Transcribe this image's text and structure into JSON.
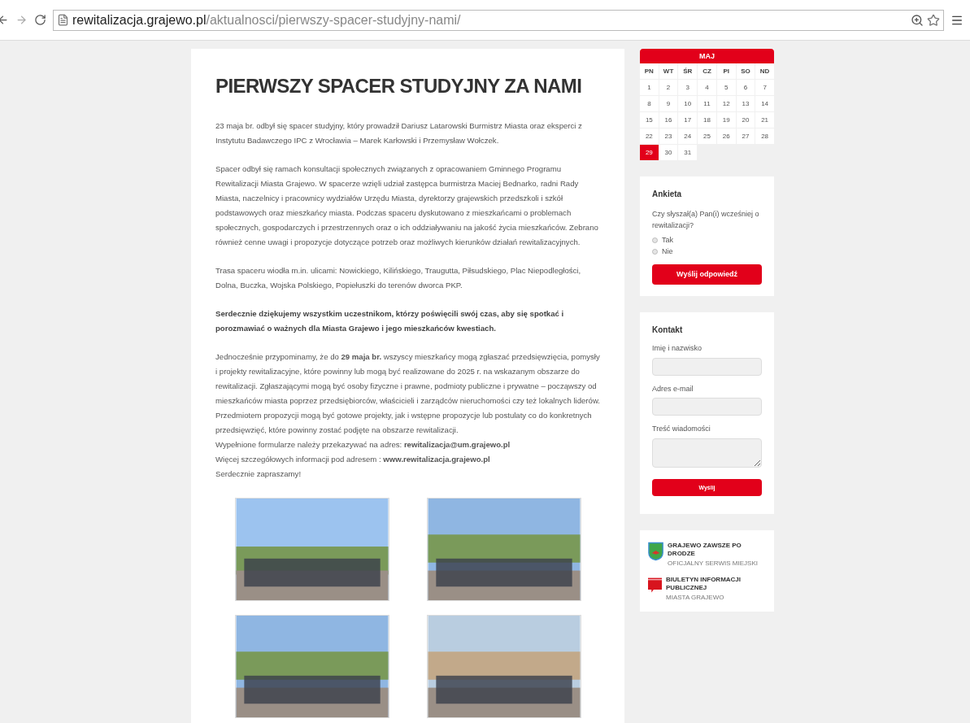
{
  "browser": {
    "url_host": "rewitalizacja.grajewo.pl",
    "url_path": "/aktualnosci/pierwszy-spacer-studyjny-nami/"
  },
  "article": {
    "title": "PIERWSZY SPACER STUDYJNY ZA NAMI",
    "paragraphs": [
      {
        "kind": "text",
        "text": "23 maja br. odbył się spacer studyjny, który prowadził Dariusz Latarowski Burmistrz Miasta oraz eksperci z Instytutu Badawczego IPC z Wrocławia – Marek Karłowski i Przemysław Wołczek."
      },
      {
        "kind": "text",
        "text": "Spacer odbył się ramach konsultacji społecznych związanych z opracowaniem Gminnego Programu Rewitalizacji Miasta Grajewo. W spacerze wzięli udział zastępca burmistrza Maciej Bednarko, radni Rady Miasta, naczelnicy i pracownicy wydziałów Urzędu Miasta, dyrektorzy grajewskich przedszkoli i szkół podstawowych oraz mieszkańcy miasta. Podczas spaceru dyskutowano z mieszkańcami o problemach społecznych, gospodarczych i przestrzennych oraz o ich oddziaływaniu na jakość życia mieszkańców. Zebrano również cenne uwagi i propozycje dotyczące potrzeb oraz możliwych kierunków działań rewitalizacyjnych."
      },
      {
        "kind": "text",
        "text": "Trasa spaceru wiodła m.in. ulicami: Nowickiego, Kilińskiego, Traugutta, Piłsudskiego, Plac Niepodległości, Dolna, Buczka, Wojska Polskiego, Popiełuszki do terenów dworca PKP."
      },
      {
        "kind": "bold",
        "text": "Serdecznie dziękujemy wszystkim uczestnikom, którzy poświęcili swój czas, aby się spotkać i porozmawiać o ważnych dla Miasta Grajewo i jego mieszkańców kwestiach."
      },
      {
        "kind": "text",
        "text": "Jednocześnie przypominamy, że do **29 maja br.** wszyscy mieszkańcy mogą zgłaszać przedsięwzięcia, pomysły i projekty rewitalizacyjne, które powinny lub mogą być realizowane do 2025 r. na wskazanym obszarze do rewitalizacji. Zgłaszającymi mogą być osoby fizyczne i prawne, podmioty publiczne i prywatne – począwszy od mieszkańców miasta poprzez przedsiębiorców, właścicieli i zarządców nieruchomości czy też lokalnych liderów. Przedmiotem propozycji mogą być gotowe projekty, jak i wstępne propozycje lub postulaty co do konkretnych przedsięwzięć, które powinny zostać podjęte na obszarze rewitalizacji."
      },
      {
        "kind": "line",
        "text": "Wypełnione formularze należy przekazywać na adres:  **rewitalizacja@um.grajewo.pl**"
      },
      {
        "kind": "line",
        "text": "Więcej szczegółowych informacji pod adresem : **www.rewitalizacja.grajewo.pl**"
      },
      {
        "kind": "line",
        "text": "Serdecznie zapraszamy!"
      }
    ],
    "photos": [
      {
        "kind": "sky"
      },
      {
        "kind": "street"
      },
      {
        "kind": "street"
      },
      {
        "kind": "building"
      }
    ]
  },
  "calendar": {
    "month": "MAJ",
    "weekdays": [
      "PN",
      "WT",
      "ŚR",
      "CZ",
      "PI",
      "SO",
      "ND"
    ],
    "weeks": [
      [
        {
          "day": "1",
          "selected": false
        },
        {
          "day": "2",
          "selected": false
        },
        {
          "day": "3",
          "selected": false
        },
        {
          "day": "4",
          "selected": false
        },
        {
          "day": "5",
          "selected": false
        },
        {
          "day": "6",
          "selected": false
        },
        {
          "day": "7",
          "selected": false
        }
      ],
      [
        {
          "day": "8",
          "selected": false
        },
        {
          "day": "9",
          "selected": false
        },
        {
          "day": "10",
          "selected": false
        },
        {
          "day": "11",
          "selected": false
        },
        {
          "day": "12",
          "selected": false
        },
        {
          "day": "13",
          "selected": false
        },
        {
          "day": "14",
          "selected": false
        }
      ],
      [
        {
          "day": "15",
          "selected": false
        },
        {
          "day": "16",
          "selected": false
        },
        {
          "day": "17",
          "selected": false
        },
        {
          "day": "18",
          "selected": false
        },
        {
          "day": "19",
          "selected": false
        },
        {
          "day": "20",
          "selected": false
        },
        {
          "day": "21",
          "selected": false
        }
      ],
      [
        {
          "day": "22",
          "selected": false
        },
        {
          "day": "23",
          "selected": false
        },
        {
          "day": "24",
          "selected": false
        },
        {
          "day": "25",
          "selected": false
        },
        {
          "day": "26",
          "selected": false
        },
        {
          "day": "27",
          "selected": false
        },
        {
          "day": "28",
          "selected": false
        }
      ],
      [
        {
          "day": "29",
          "selected": true
        },
        {
          "day": "30",
          "selected": false
        },
        {
          "day": "31",
          "selected": false
        }
      ]
    ]
  },
  "poll": {
    "title": "Ankieta",
    "question": "Czy słyszał(a) Pan(i) wcześniej o rewitalizacji?",
    "options": [
      {
        "label": "Tak",
        "selected": false
      },
      {
        "label": "Nie",
        "selected": false
      }
    ],
    "button": "Wyślij odpowiedź"
  },
  "contact": {
    "title": "Kontakt",
    "fields": [
      {
        "label": "Imię i nazwisko",
        "kind": "input"
      },
      {
        "label": "Adres e-mail",
        "kind": "input"
      },
      {
        "label": "Treść wiadomości",
        "kind": "textarea"
      }
    ],
    "button": "Wyślij"
  },
  "links": [
    {
      "kind": "crest",
      "title": "GRAJEWO ZAWSZE PO DRODZE",
      "subtitle": "OFICJALNY SERWIS MIEJSKI"
    },
    {
      "kind": "bip",
      "title": "BIULETYN INFORMACJI PUBLICZNEJ",
      "subtitle": "MIASTA GRAJEWO"
    }
  ]
}
